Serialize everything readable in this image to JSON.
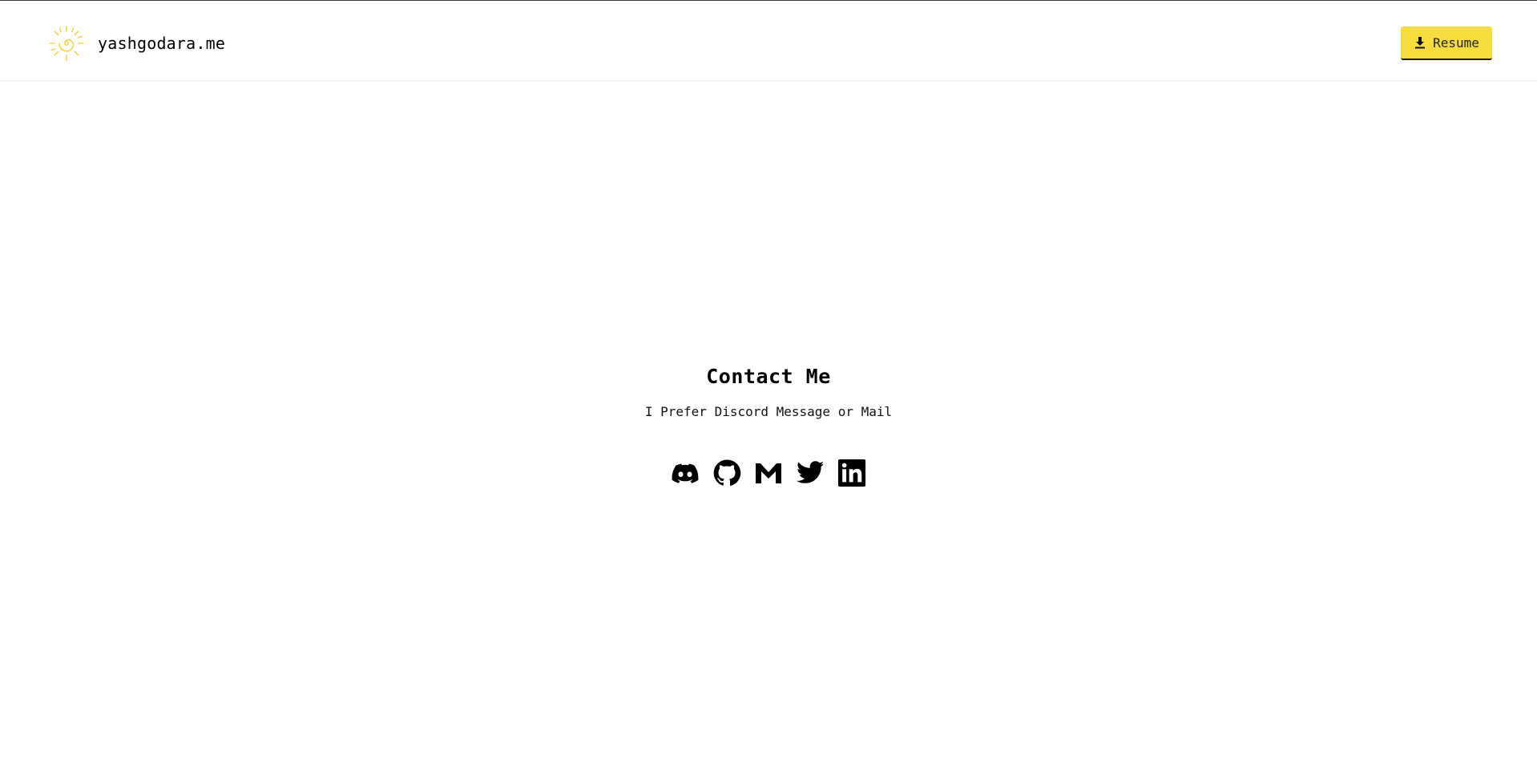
{
  "header": {
    "site_name": "yashgodara.me",
    "resume_label": "Resume"
  },
  "contact": {
    "title": "Contact Me",
    "subtitle": "I Prefer Discord Message or Mail"
  },
  "socials": [
    {
      "icon": "discord-icon"
    },
    {
      "icon": "github-icon"
    },
    {
      "icon": "gmail-icon"
    },
    {
      "icon": "twitter-icon"
    },
    {
      "icon": "linkedin-icon"
    }
  ],
  "colors": {
    "accent": "#f7dc3e",
    "logo": "#f5d547",
    "text": "#000000"
  }
}
